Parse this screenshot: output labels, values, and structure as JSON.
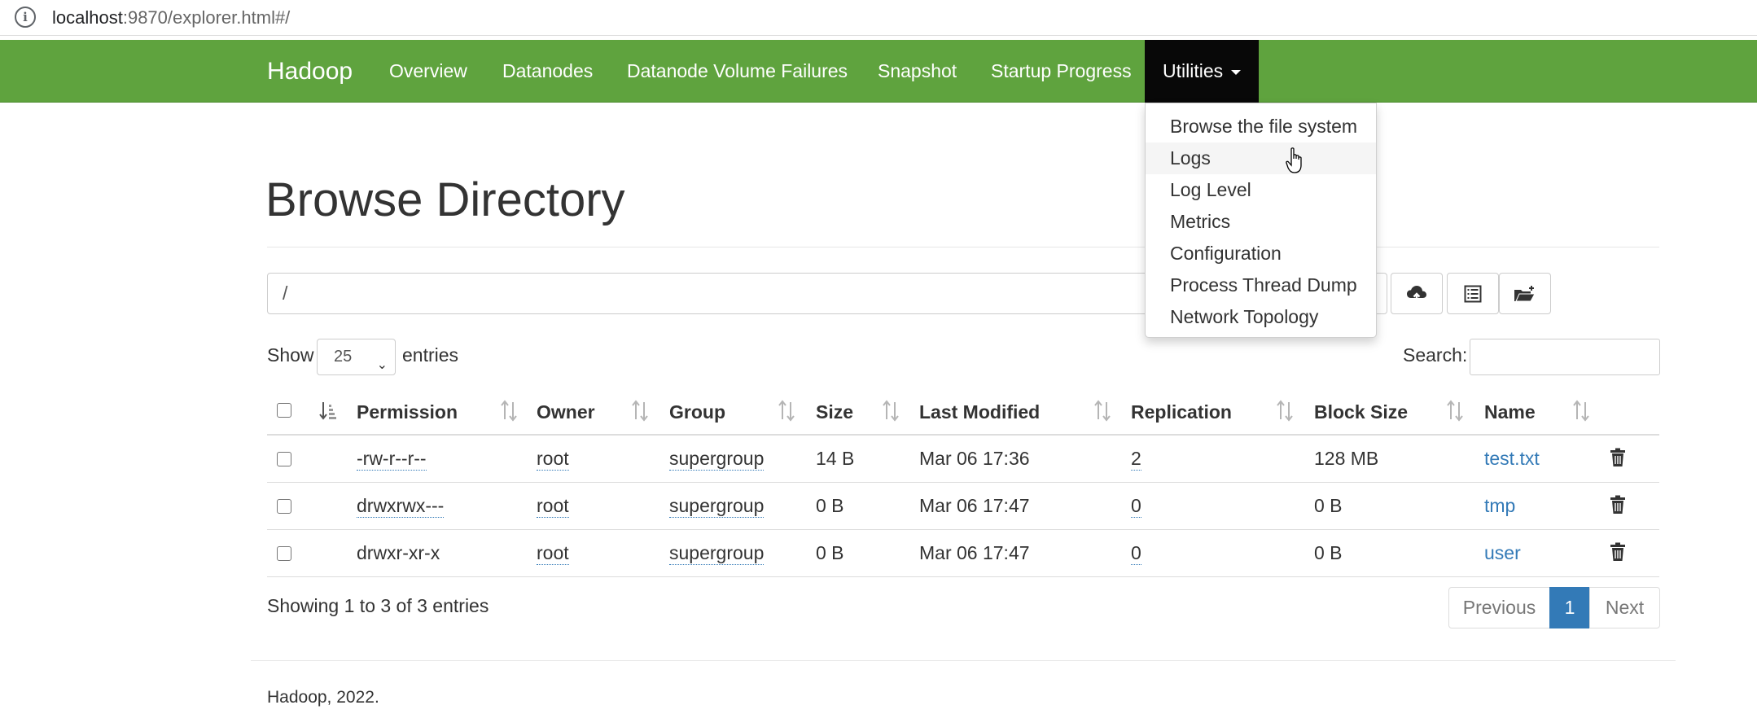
{
  "browser": {
    "url_host": "localhost",
    "url_rest": ":9870/explorer.html#/"
  },
  "navbar": {
    "brand": "Hadoop",
    "items": [
      {
        "label": "Overview"
      },
      {
        "label": "Datanodes"
      },
      {
        "label": "Datanode Volume Failures"
      },
      {
        "label": "Snapshot"
      },
      {
        "label": "Startup Progress"
      },
      {
        "label": "Utilities",
        "active": true
      }
    ],
    "bg_color": "#5fa33e",
    "active_bg": "#080808"
  },
  "dropdown": {
    "items": [
      {
        "label": "Browse the file system"
      },
      {
        "label": "Logs",
        "hovered": true
      },
      {
        "label": "Log Level"
      },
      {
        "label": "Metrics"
      },
      {
        "label": "Configuration"
      },
      {
        "label": "Process Thread Dump"
      },
      {
        "label": "Network Topology"
      }
    ]
  },
  "page": {
    "title": "Browse Directory",
    "path_value": "/"
  },
  "toolbar": {
    "icons": [
      "upload-cloud-icon",
      "list-icon",
      "create-folder-icon"
    ]
  },
  "table_controls": {
    "show_label": "Show",
    "page_length": "25",
    "entries_label": "entries",
    "search_label": "Search:"
  },
  "table": {
    "columns": [
      "Permission",
      "Owner",
      "Group",
      "Size",
      "Last Modified",
      "Replication",
      "Block Size",
      "Name"
    ],
    "rows": [
      {
        "permission": "-rw-r--r--",
        "owner": "root",
        "group": "supergroup",
        "size": "14 B",
        "last_modified": "Mar 06 17:36",
        "replication": "2",
        "block_size": "128 MB",
        "name": "test.txt"
      },
      {
        "permission": "drwxrwx---",
        "owner": "root",
        "group": "supergroup",
        "size": "0 B",
        "last_modified": "Mar 06 17:47",
        "replication": "0",
        "block_size": "0 B",
        "name": "tmp"
      },
      {
        "permission": "drwxr-xr-x",
        "owner": "root",
        "group": "supergroup",
        "size": "0 B",
        "last_modified": "Mar 06 17:47",
        "replication": "0",
        "block_size": "0 B",
        "name": "user"
      }
    ],
    "link_color": "#337ab7"
  },
  "pagination": {
    "info": "Showing 1 to 3 of 3 entries",
    "previous": "Previous",
    "current": "1",
    "next": "Next"
  },
  "footer": {
    "text": "Hadoop, 2022."
  }
}
